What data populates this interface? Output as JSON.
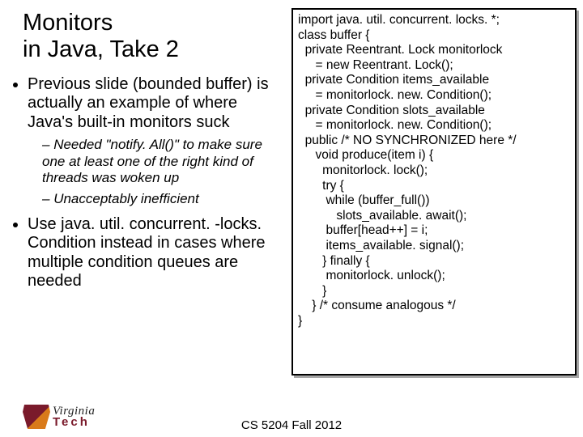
{
  "title_line1": "Monitors",
  "title_line2": "in Java, Take 2",
  "bullets": {
    "b1": "Previous slide (bounded buffer) is actually an example of where Java's built-in monitors suck",
    "b1s1": "Needed \"notify. All()\" to make sure one at least one of the right kind of threads was woken up",
    "b1s2": "Unacceptably inefficient",
    "b2": "Use java. util. concurrent. -locks. Condition instead in cases where multiple condition queues are needed"
  },
  "code": "import java. util. concurrent. locks. *;\nclass buffer {\n  private Reentrant. Lock monitorlock\n     = new Reentrant. Lock();\n  private Condition items_available\n     = monitorlock. new. Condition();\n  private Condition slots_available\n     = monitorlock. new. Condition();\n  public /* NO SYNCHRONIZED here */\n     void produce(item i) {\n       monitorlock. lock();\n       try {\n        while (buffer_full())\n           slots_available. await();\n        buffer[head++] = i;\n        items_available. signal();\n       } finally {\n        monitorlock. unlock();\n       }\n    } /* consume analogous */\n}",
  "footer": "CS 5204 Fall 2012",
  "logo": {
    "line1": "Virginia",
    "line2": "Tech"
  }
}
